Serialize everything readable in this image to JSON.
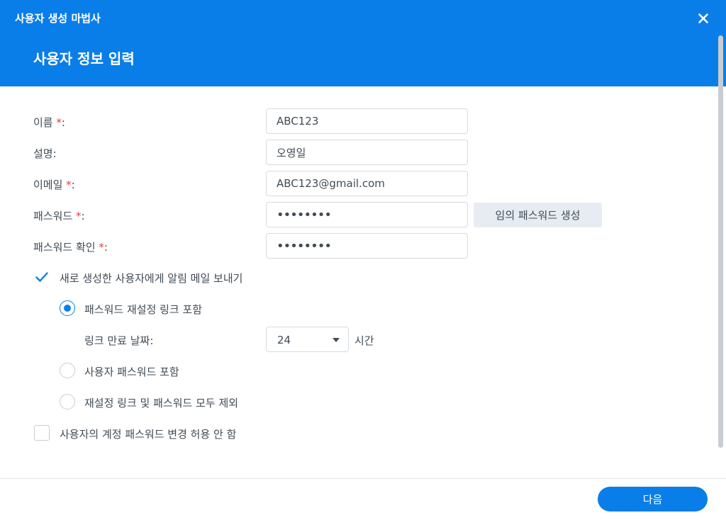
{
  "window": {
    "title": "사용자 생성 마법사",
    "close_icon": "close-icon"
  },
  "step": {
    "title": "사용자 정보 입력"
  },
  "form": {
    "name": {
      "label": "이름 ",
      "required": "*",
      "suffix": ":",
      "value": "ABC123"
    },
    "description": {
      "label": "설명:",
      "value": "오영일"
    },
    "email": {
      "label": "이메일 ",
      "required": "*",
      "suffix": ":",
      "value": "ABC123@gmail.com"
    },
    "password": {
      "label": "패스워드 ",
      "required": "*",
      "suffix": ":",
      "value": "••••••••"
    },
    "password_confirm": {
      "label": "패스워드 확인 ",
      "required": "*",
      "suffix": ":",
      "value": "••••••••"
    },
    "random_password_label": "임의 패스워드 생성"
  },
  "notify": {
    "label": "새로 생성한 사용자에게 알림 메일 보내기",
    "checked": true,
    "options": [
      {
        "label": "패스워드 재설정 링크 포함",
        "selected": true
      },
      {
        "label": "사용자 패스워드 포함",
        "selected": false
      },
      {
        "label": "재설정 링크 및 패스워드 모두 제외",
        "selected": false
      }
    ],
    "expiry": {
      "label": "링크 만료 날짜:",
      "value": "24",
      "unit": "시간"
    }
  },
  "disallow_change": {
    "label": "사용자의 계정 패스워드 변경 허용 안 함",
    "checked": false
  },
  "footer": {
    "next_label": "다음"
  },
  "colors": {
    "accent": "#0a7ee8",
    "required": "#e03e3e",
    "text": "#414b55"
  }
}
